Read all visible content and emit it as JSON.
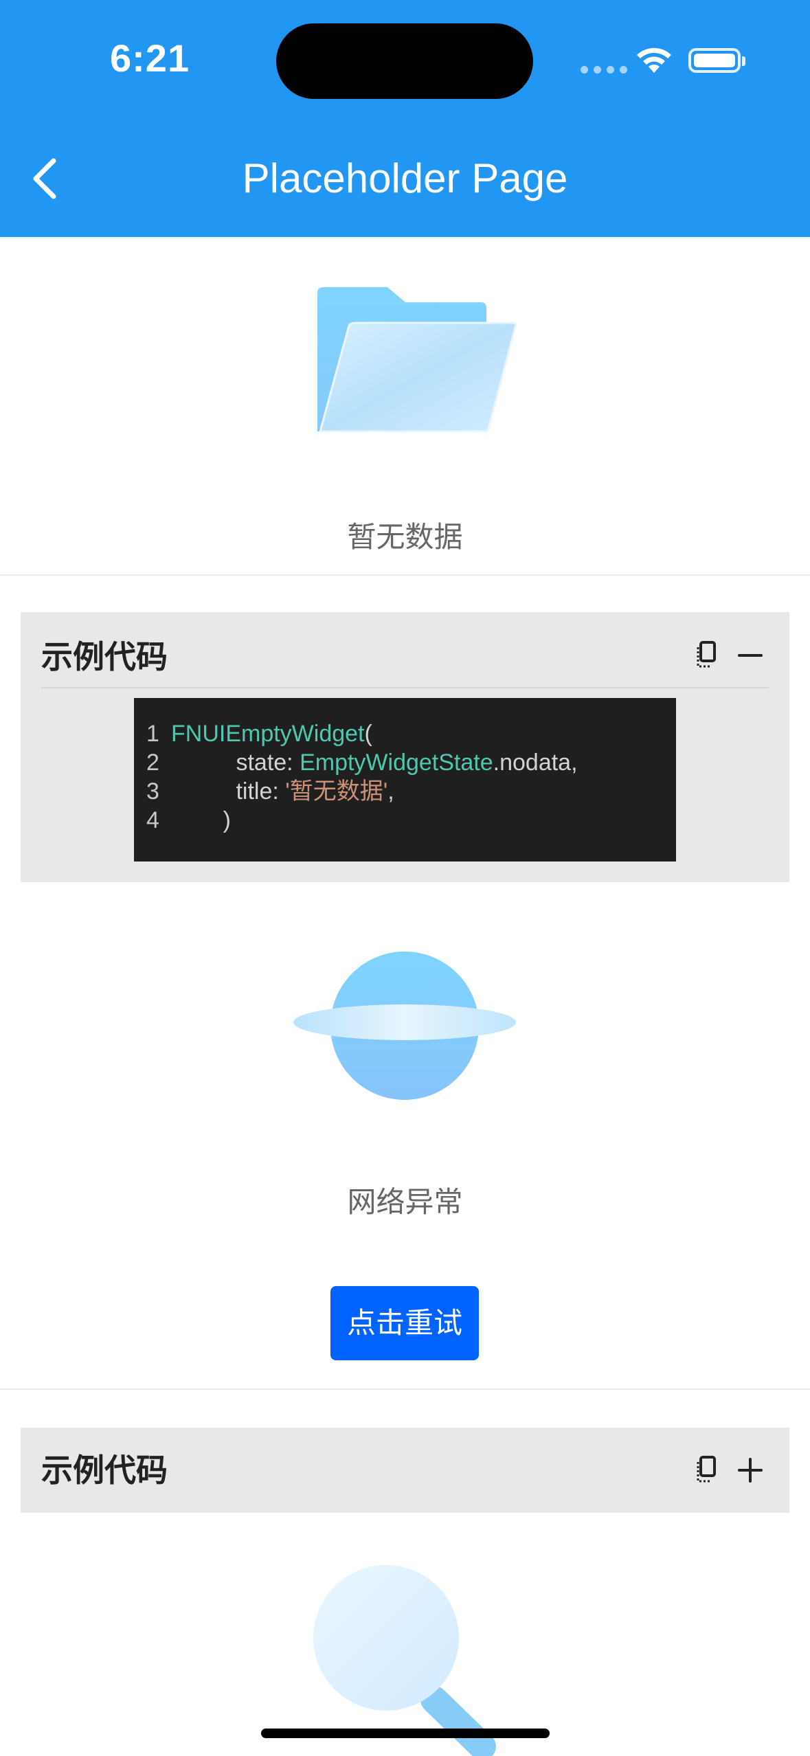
{
  "status_bar": {
    "time": "6:21"
  },
  "header": {
    "title": "Placeholder Page",
    "back_icon": "chevron-left-icon"
  },
  "empty_state": {
    "icon": "folder-icon",
    "caption": "暂无数据"
  },
  "code_card_1": {
    "title": "示例代码",
    "copy_icon": "copy-icon",
    "toggle_icon": "minus-icon",
    "line_numbers": [
      "1",
      "2",
      "3",
      "4"
    ],
    "lines": [
      {
        "indent": "",
        "parts": [
          {
            "text": "FNUIEmptyWidget",
            "kind": "class"
          },
          {
            "text": "(",
            "kind": "plain"
          }
        ]
      },
      {
        "indent": "          ",
        "parts": [
          {
            "text": "state: ",
            "kind": "plain"
          },
          {
            "text": "EmptyWidgetState",
            "kind": "class"
          },
          {
            "text": ".nodata,",
            "kind": "plain"
          }
        ]
      },
      {
        "indent": "          ",
        "parts": [
          {
            "text": "title: ",
            "kind": "plain"
          },
          {
            "text": "'暂无数据'",
            "kind": "string"
          },
          {
            "text": ",",
            "kind": "plain"
          }
        ]
      },
      {
        "indent": "        ",
        "parts": [
          {
            "text": ")",
            "kind": "plain"
          }
        ]
      }
    ]
  },
  "network_state": {
    "icon": "planet-icon",
    "caption": "网络异常",
    "retry_label": "点击重试"
  },
  "code_card_2": {
    "title": "示例代码",
    "copy_icon": "copy-icon",
    "toggle_icon": "plus-icon"
  },
  "search_state": {
    "icon": "magnifier-icon"
  },
  "colors": {
    "header": "#2196f3",
    "retry_button": "#0062ff",
    "code_bg": "#1f1f1f",
    "code_class": "#4ec9b0",
    "code_string": "#ce9178"
  }
}
